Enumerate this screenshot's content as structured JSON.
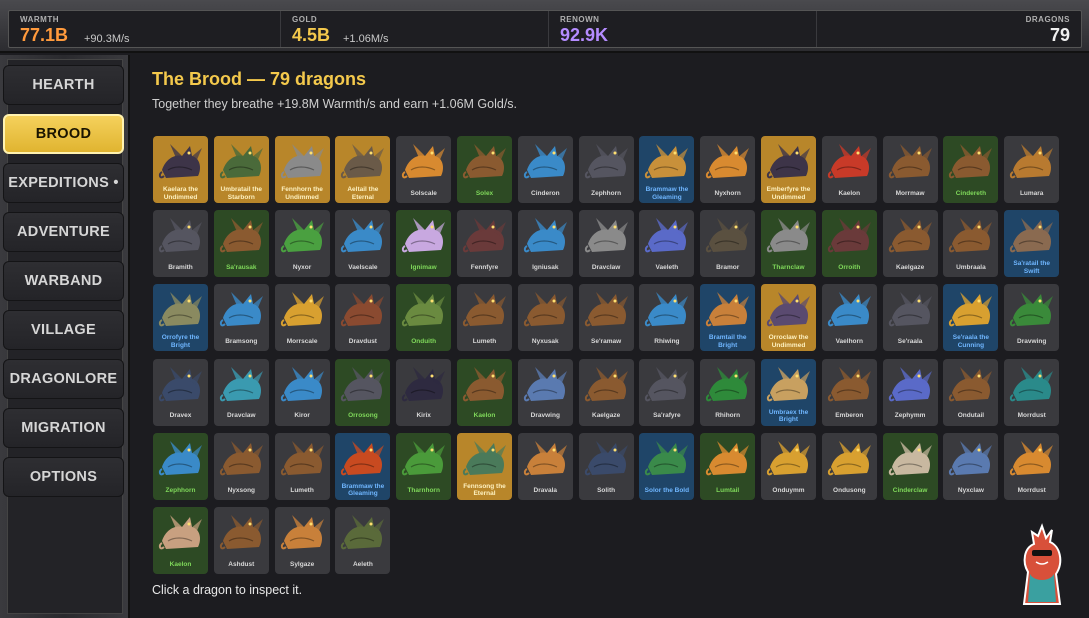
{
  "resources": [
    {
      "label": "WARMTH",
      "value": "77.1B",
      "rate": "+90.3M/s",
      "color": "#ff9a3c"
    },
    {
      "label": "GOLD",
      "value": "4.5B",
      "rate": "+1.06M/s",
      "color": "#f4c94c"
    },
    {
      "label": "RENOWN",
      "value": "92.9K",
      "rate": "",
      "color": "#b58cff"
    }
  ],
  "dragons_counter": {
    "label": "DRAGONS",
    "value": "79"
  },
  "sidebar": {
    "items": [
      {
        "label": "HEARTH",
        "active": false
      },
      {
        "label": "BROOD",
        "active": true
      },
      {
        "label": "EXPEDITIONS •",
        "active": false
      },
      {
        "label": "ADVENTURE",
        "active": false
      },
      {
        "label": "WARBAND",
        "active": false
      },
      {
        "label": "VILLAGE",
        "active": false
      },
      {
        "label": "DRAGONLORE",
        "active": false
      },
      {
        "label": "MIGRATION",
        "active": false
      },
      {
        "label": "OPTIONS",
        "active": false
      }
    ]
  },
  "main": {
    "title": "The Brood",
    "title_sep": " — ",
    "title_count": "79 dragons",
    "subtitle": "Together they breathe +19.8M Warmth/s and earn +1.06M Gold/s.",
    "hint": "Click a dragon to inspect it."
  },
  "colors": {
    "gray": "#3a3a3e",
    "green": "#2d4a24",
    "blue": "#1f4568",
    "gold": "#b8862a"
  },
  "dragons": [
    {
      "name": "Kaelara the Undimmed",
      "tier": "gold",
      "color": "#3d3448"
    },
    {
      "name": "Umbratail the Starborn",
      "tier": "gold",
      "color": "#4a6a3a"
    },
    {
      "name": "Fennhorn the Undimmed",
      "tier": "gold",
      "color": "#8a8a8a"
    },
    {
      "name": "Aeltail the Eternal",
      "tier": "gold",
      "color": "#6a5a48"
    },
    {
      "name": "Solscale",
      "tier": "gray",
      "color": "#d88a30"
    },
    {
      "name": "Solex",
      "tier": "green",
      "color": "#8a5a30"
    },
    {
      "name": "Cinderon",
      "tier": "gray",
      "color": "#3a8ac8"
    },
    {
      "name": "Zephhorn",
      "tier": "gray",
      "color": "#555560"
    },
    {
      "name": "Brammaw the Gleaming",
      "tier": "blue",
      "color": "#c8903a"
    },
    {
      "name": "Nyxhorn",
      "tier": "gray",
      "color": "#d88a30"
    },
    {
      "name": "Emberfyre the Undimmed",
      "tier": "gold",
      "color": "#3d3448"
    },
    {
      "name": "Kaelon",
      "tier": "gray",
      "color": "#c83a28"
    },
    {
      "name": "Morrmaw",
      "tier": "gray",
      "color": "#8a5a30"
    },
    {
      "name": "Cindereth",
      "tier": "green",
      "color": "#8a5a30"
    },
    {
      "name": "Lumara",
      "tier": "gray",
      "color": "#b87a30"
    },
    {
      "name": "Bramith",
      "tier": "gray",
      "color": "#555560"
    },
    {
      "name": "Sa'rausak",
      "tier": "green",
      "color": "#8a5a30"
    },
    {
      "name": "Nyxor",
      "tier": "gray",
      "color": "#4aa040"
    },
    {
      "name": "Vaelscale",
      "tier": "gray",
      "color": "#3a8ac8"
    },
    {
      "name": "Ignimaw",
      "tier": "green",
      "color": "#c8a8e0"
    },
    {
      "name": "Fennfyre",
      "tier": "gray",
      "color": "#6a3a3a"
    },
    {
      "name": "Igniusak",
      "tier": "gray",
      "color": "#3a8ac8"
    },
    {
      "name": "Dravclaw",
      "tier": "gray",
      "color": "#8a8a8a"
    },
    {
      "name": "Vaeleth",
      "tier": "gray",
      "color": "#5a6ac8"
    },
    {
      "name": "Bramor",
      "tier": "gray",
      "color": "#5a5040"
    },
    {
      "name": "Tharnclaw",
      "tier": "green",
      "color": "#8a8a8a"
    },
    {
      "name": "Orroith",
      "tier": "green",
      "color": "#6a3a3a"
    },
    {
      "name": "Kaelgaze",
      "tier": "gray",
      "color": "#8a5a30"
    },
    {
      "name": "Umbraala",
      "tier": "gray",
      "color": "#8a5a30"
    },
    {
      "name": "Sa'ratail the Swift",
      "tier": "blue",
      "color": "#8a6a50"
    },
    {
      "name": "Orrofyre the Bright",
      "tier": "blue",
      "color": "#8a8a60"
    },
    {
      "name": "Bramsong",
      "tier": "gray",
      "color": "#3a8ac8"
    },
    {
      "name": "Morrscale",
      "tier": "gray",
      "color": "#d8a030"
    },
    {
      "name": "Dravdust",
      "tier": "gray",
      "color": "#8a4a30"
    },
    {
      "name": "Onduith",
      "tier": "green",
      "color": "#6a8a40"
    },
    {
      "name": "Lumeth",
      "tier": "gray",
      "color": "#8a5a30"
    },
    {
      "name": "Nyxusak",
      "tier": "gray",
      "color": "#8a5a30"
    },
    {
      "name": "Se'ramaw",
      "tier": "gray",
      "color": "#8a5a30"
    },
    {
      "name": "Rhiwing",
      "tier": "gray",
      "color": "#3a8ac8"
    },
    {
      "name": "Bramtail the Bright",
      "tier": "blue",
      "color": "#c8803a"
    },
    {
      "name": "Orroclaw the Undimmed",
      "tier": "gold",
      "color": "#5a4a70"
    },
    {
      "name": "Vaelhorn",
      "tier": "gray",
      "color": "#3a8ac8"
    },
    {
      "name": "Se'raala",
      "tier": "gray",
      "color": "#555560"
    },
    {
      "name": "Se'raala the Cunning",
      "tier": "blue",
      "color": "#d8a030"
    },
    {
      "name": "Dravwing",
      "tier": "gray",
      "color": "#3a8a3a"
    },
    {
      "name": "Dravex",
      "tier": "gray",
      "color": "#3a4a6a"
    },
    {
      "name": "Dravclaw",
      "tier": "gray",
      "color": "#3a9ab0"
    },
    {
      "name": "Kiror",
      "tier": "gray",
      "color": "#3a8ac8"
    },
    {
      "name": "Orrosong",
      "tier": "green",
      "color": "#555560"
    },
    {
      "name": "Kirix",
      "tier": "gray",
      "color": "#2e2a40"
    },
    {
      "name": "Kaelon",
      "tier": "green",
      "color": "#8a5a30"
    },
    {
      "name": "Dravwing",
      "tier": "gray",
      "color": "#5a7ab0"
    },
    {
      "name": "Kaelgaze",
      "tier": "gray",
      "color": "#8a5a30"
    },
    {
      "name": "Sa'rafyre",
      "tier": "gray",
      "color": "#555560"
    },
    {
      "name": "Rhihorn",
      "tier": "gray",
      "color": "#2e8a3a"
    },
    {
      "name": "Umbraex the Bright",
      "tier": "blue",
      "color": "#c8a060"
    },
    {
      "name": "Emberon",
      "tier": "gray",
      "color": "#8a5a30"
    },
    {
      "name": "Zephymm",
      "tier": "gray",
      "color": "#5a6ac8"
    },
    {
      "name": "Ondutail",
      "tier": "gray",
      "color": "#8a5a30"
    },
    {
      "name": "Morrdust",
      "tier": "gray",
      "color": "#2a8a8a"
    },
    {
      "name": "Zephhorn",
      "tier": "green",
      "color": "#3a8ac8"
    },
    {
      "name": "Nyxsong",
      "tier": "gray",
      "color": "#8a5a30"
    },
    {
      "name": "Lumeth",
      "tier": "gray",
      "color": "#8a5a30"
    },
    {
      "name": "Brammaw the Gleaming",
      "tier": "blue",
      "color": "#c84a20"
    },
    {
      "name": "Tharnhorn",
      "tier": "green",
      "color": "#4a9a3a"
    },
    {
      "name": "Fennsong the Eternal",
      "tier": "gold",
      "color": "#4a7a5a"
    },
    {
      "name": "Dravala",
      "tier": "gray",
      "color": "#c8803a"
    },
    {
      "name": "Solith",
      "tier": "gray",
      "color": "#3a4a6a"
    },
    {
      "name": "Solor the Bold",
      "tier": "blue",
      "color": "#3a8a4a"
    },
    {
      "name": "Lumtail",
      "tier": "green",
      "color": "#d88a30"
    },
    {
      "name": "Onduymm",
      "tier": "gray",
      "color": "#d8a030"
    },
    {
      "name": "Ondusong",
      "tier": "gray",
      "color": "#d8a030"
    },
    {
      "name": "Cinderclaw",
      "tier": "green",
      "color": "#c8b8a0"
    },
    {
      "name": "Nyxclaw",
      "tier": "gray",
      "color": "#5a7ab0"
    },
    {
      "name": "Morrdust",
      "tier": "gray",
      "color": "#d88a30"
    },
    {
      "name": "Kaelon",
      "tier": "green",
      "color": "#c8a080"
    },
    {
      "name": "Ashdust",
      "tier": "gray",
      "color": "#8a5a30"
    },
    {
      "name": "Sylgaze",
      "tier": "gray",
      "color": "#c8803a"
    },
    {
      "name": "Aeleth",
      "tier": "gray",
      "color": "#5a6a3a"
    }
  ]
}
